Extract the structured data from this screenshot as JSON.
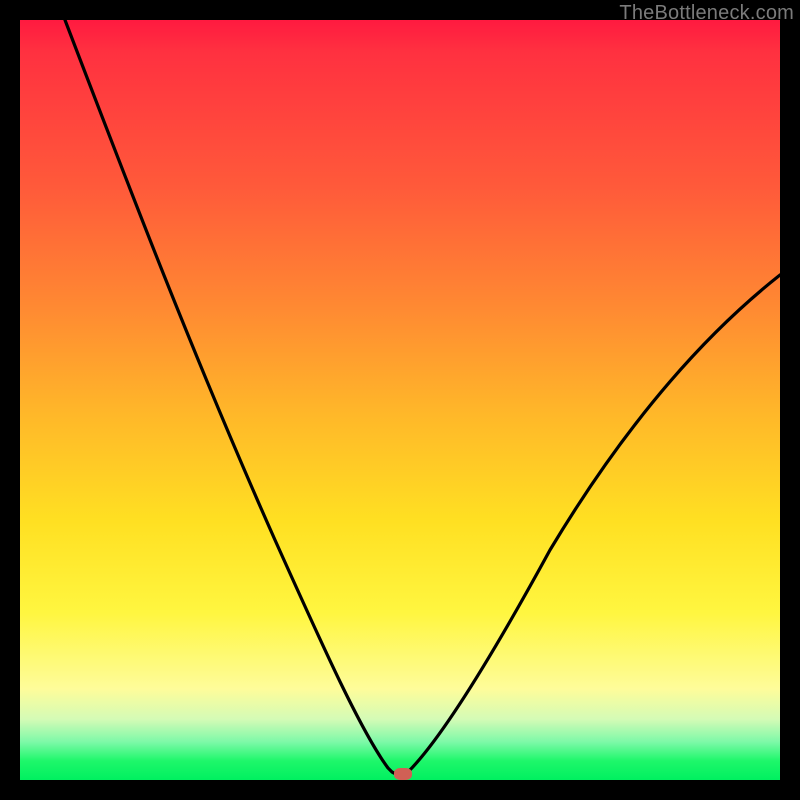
{
  "watermark": "TheBottleneck.com",
  "chart_data": {
    "type": "line",
    "title": "",
    "xlabel": "",
    "ylabel": "",
    "xlim": [
      0,
      100
    ],
    "ylim": [
      0,
      100
    ],
    "grid": false,
    "legend": false,
    "background_gradient": {
      "direction": "vertical",
      "stops": [
        {
          "pos": 0,
          "color": "#ff1a40",
          "meaning": "high-bottleneck"
        },
        {
          "pos": 50,
          "color": "#ffb829",
          "meaning": "mid"
        },
        {
          "pos": 80,
          "color": "#fff640",
          "meaning": "low"
        },
        {
          "pos": 100,
          "color": "#00f060",
          "meaning": "zero-bottleneck"
        }
      ]
    },
    "series": [
      {
        "name": "bottleneck-curve-left",
        "x": [
          0,
          5,
          10,
          15,
          20,
          25,
          30,
          35,
          40,
          45,
          48,
          50
        ],
        "y": [
          100,
          92,
          83,
          74,
          64,
          54,
          43,
          32,
          20,
          8,
          2,
          0
        ]
      },
      {
        "name": "bottleneck-curve-right",
        "x": [
          50,
          53,
          57,
          62,
          68,
          75,
          82,
          90,
          100
        ],
        "y": [
          0,
          2,
          8,
          16,
          26,
          37,
          47,
          56,
          66
        ]
      }
    ],
    "marker": {
      "name": "selected-config",
      "x": 50,
      "y": 0,
      "color": "#d06055"
    }
  }
}
